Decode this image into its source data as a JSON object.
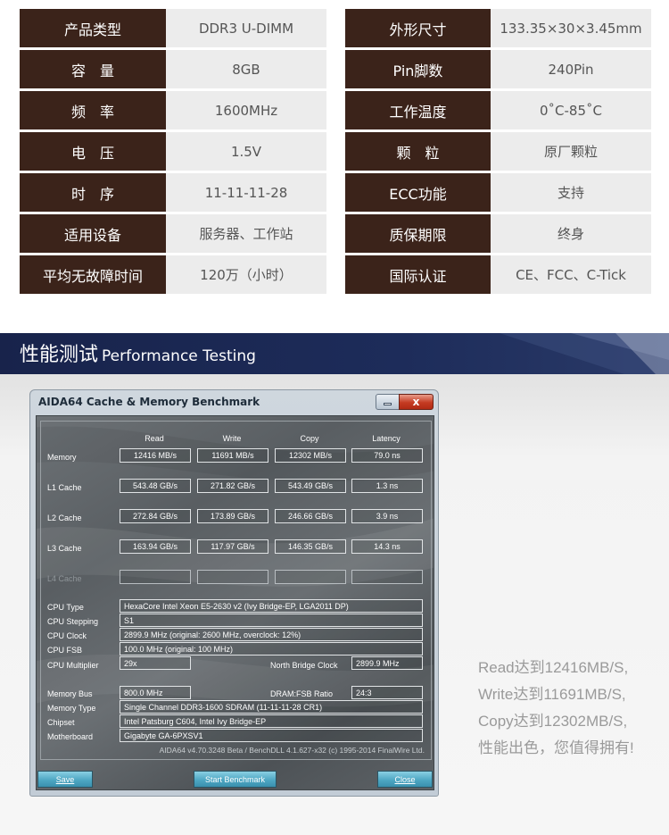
{
  "spec_table": {
    "rows": [
      {
        "label1": "产品类型",
        "value1": "DDR3 U-DIMM",
        "label2": "外形尺寸",
        "value2": "133.35×30×3.45mm"
      },
      {
        "label1": "容　量",
        "value1": "8GB",
        "label2": "Pin脚数",
        "value2": "240Pin"
      },
      {
        "label1": "频　率",
        "value1": "1600MHz",
        "label2": "工作温度",
        "value2": "0˚C-85˚C"
      },
      {
        "label1": "电　压",
        "value1": "1.5V",
        "label2": "颗　粒",
        "value2": "原厂颗粒"
      },
      {
        "label1": "时　序",
        "value1": "11-11-11-28",
        "label2": "ECC功能",
        "value2": "支持"
      },
      {
        "label1": "适用设备",
        "value1": "服务器、工作站",
        "label2": "质保期限",
        "value2": "终身"
      },
      {
        "label1": "平均无故障时间",
        "value1": "120万（小时）",
        "label2": "国际认证",
        "value2": "CE、FCC、C-Tick"
      }
    ]
  },
  "banner": {
    "title_cn": "性能测试",
    "title_en": "Performance Testing"
  },
  "aida": {
    "window_title": "AIDA64 Cache & Memory Benchmark",
    "close_glyph": "x",
    "columns": [
      "Read",
      "Write",
      "Copy",
      "Latency"
    ],
    "rows": [
      {
        "label": "Memory",
        "read": "12416 MB/s",
        "write": "11691 MB/s",
        "copy": "12302 MB/s",
        "latency": "79.0 ns"
      },
      {
        "label": "L1 Cache",
        "read": "543.48 GB/s",
        "write": "271.82 GB/s",
        "copy": "543.49 GB/s",
        "latency": "1.3 ns"
      },
      {
        "label": "L2 Cache",
        "read": "272.84 GB/s",
        "write": "173.89 GB/s",
        "copy": "246.66 GB/s",
        "latency": "3.9 ns"
      },
      {
        "label": "L3 Cache",
        "read": "163.94 GB/s",
        "write": "117.97 GB/s",
        "copy": "146.35 GB/s",
        "latency": "14.3 ns"
      },
      {
        "label": "L4 Cache",
        "read": "",
        "write": "",
        "copy": "",
        "latency": ""
      }
    ],
    "cpu": {
      "type_label": "CPU Type",
      "type_value": "HexaCore Intel Xeon E5-2630 v2  (Ivy Bridge-EP, LGA2011 DP)",
      "stepping_label": "CPU Stepping",
      "stepping_value": "S1",
      "clock_label": "CPU Clock",
      "clock_value": "2899.9 MHz  (original: 2600 MHz, overclock: 12%)",
      "fsb_label": "CPU FSB",
      "fsb_value": "100.0 MHz  (original: 100 MHz)",
      "mult_label": "CPU Multiplier",
      "mult_value": "29x",
      "nb_label": "North Bridge Clock",
      "nb_value": "2899.9 MHz"
    },
    "mem": {
      "bus_label": "Memory Bus",
      "bus_value": "800.0 MHz",
      "ratio_label": "DRAM:FSB Ratio",
      "ratio_value": "24:3",
      "type_label": "Memory Type",
      "type_value": "Single Channel DDR3-1600 SDRAM  (11-11-11-28 CR1)",
      "chipset_label": "Chipset",
      "chipset_value": "Intel Patsburg C604, Intel Ivy Bridge-EP",
      "mobo_label": "Motherboard",
      "mobo_value": "Gigabyte GA-6PXSV1"
    },
    "footer": "AIDA64 v4.70.3248 Beta / BenchDLL 4.1.627-x32  (c) 1995-2014 FinalWire Ltd.",
    "buttons": {
      "save": "Save",
      "start": "Start Benchmark",
      "close": "Close"
    }
  },
  "summary": {
    "lines": [
      "Read达到12416MB/S,",
      "Write达到11691MB/S,",
      "Copy达到12302MB/S,",
      "性能出色，您值得拥有!"
    ]
  },
  "colors": {
    "label_bg": "#3b231a",
    "value_bg": "#ececec",
    "banner_blue": "#1b2a57",
    "button_blue": "#4ea7c3"
  }
}
